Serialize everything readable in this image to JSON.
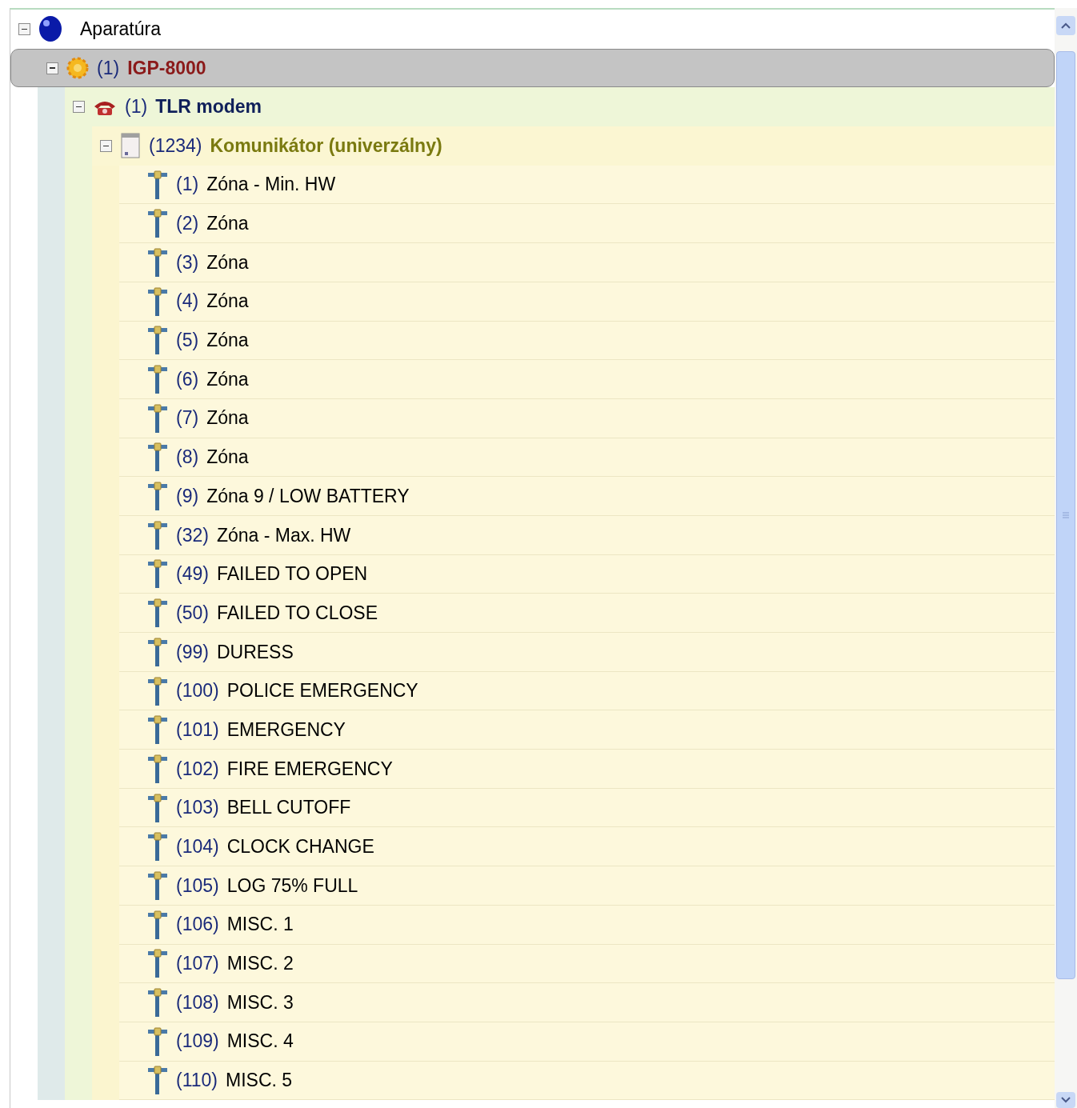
{
  "tree": [
    {
      "kind": "root",
      "name": "Aparatúra",
      "expanded": true,
      "selected": false,
      "children": [
        {
          "kind": "panel",
          "number": "(1)",
          "name": "IGP-8000",
          "expanded": true,
          "selected": true,
          "children": [
            {
              "kind": "modem",
              "number": "(1)",
              "name": "TLR modem",
              "expanded": true,
              "selected": false,
              "children": [
                {
                  "kind": "communicator",
                  "number": "(1234)",
                  "name": "Komunikátor (univerzálny)",
                  "expanded": true,
                  "selected": false,
                  "children": [
                    {
                      "kind": "zone",
                      "number": "(1)",
                      "name": "Zóna - Min. HW",
                      "selected": false
                    },
                    {
                      "kind": "zone",
                      "number": "(2)",
                      "name": "Zóna",
                      "selected": false
                    },
                    {
                      "kind": "zone",
                      "number": "(3)",
                      "name": "Zóna",
                      "selected": false
                    },
                    {
                      "kind": "zone",
                      "number": "(4)",
                      "name": "Zóna",
                      "selected": false
                    },
                    {
                      "kind": "zone",
                      "number": "(5)",
                      "name": "Zóna",
                      "selected": false
                    },
                    {
                      "kind": "zone",
                      "number": "(6)",
                      "name": "Zóna",
                      "selected": false
                    },
                    {
                      "kind": "zone",
                      "number": "(7)",
                      "name": "Zóna",
                      "selected": false
                    },
                    {
                      "kind": "zone",
                      "number": "(8)",
                      "name": "Zóna",
                      "selected": false
                    },
                    {
                      "kind": "zone",
                      "number": "(9)",
                      "name": "Zóna 9 / LOW BATTERY",
                      "selected": false
                    },
                    {
                      "kind": "zone",
                      "number": "(32)",
                      "name": "Zóna - Max. HW",
                      "selected": false
                    },
                    {
                      "kind": "zone",
                      "number": "(49)",
                      "name": "FAILED TO OPEN",
                      "selected": false
                    },
                    {
                      "kind": "zone",
                      "number": "(50)",
                      "name": "FAILED TO CLOSE",
                      "selected": false
                    },
                    {
                      "kind": "zone",
                      "number": "(99)",
                      "name": "DURESS",
                      "selected": false
                    },
                    {
                      "kind": "zone",
                      "number": "(100)",
                      "name": "POLICE EMERGENCY",
                      "selected": false
                    },
                    {
                      "kind": "zone",
                      "number": "(101)",
                      "name": "EMERGENCY",
                      "selected": false
                    },
                    {
                      "kind": "zone",
                      "number": "(102)",
                      "name": "FIRE EMERGENCY",
                      "selected": false
                    },
                    {
                      "kind": "zone",
                      "number": "(103)",
                      "name": "BELL CUTOFF",
                      "selected": false
                    },
                    {
                      "kind": "zone",
                      "number": "(104)",
                      "name": "CLOCK CHANGE",
                      "selected": false
                    },
                    {
                      "kind": "zone",
                      "number": "(105)",
                      "name": "LOG 75% FULL",
                      "selected": false
                    },
                    {
                      "kind": "zone",
                      "number": "(106)",
                      "name": "MISC. 1",
                      "selected": false
                    },
                    {
                      "kind": "zone",
                      "number": "(107)",
                      "name": "MISC. 2",
                      "selected": false
                    },
                    {
                      "kind": "zone",
                      "number": "(108)",
                      "name": "MISC. 3",
                      "selected": false
                    },
                    {
                      "kind": "zone",
                      "number": "(109)",
                      "name": "MISC. 4",
                      "selected": false
                    },
                    {
                      "kind": "zone",
                      "number": "(110)",
                      "name": "MISC. 5",
                      "selected": false
                    }
                  ]
                }
              ]
            }
          ]
        }
      ]
    }
  ]
}
